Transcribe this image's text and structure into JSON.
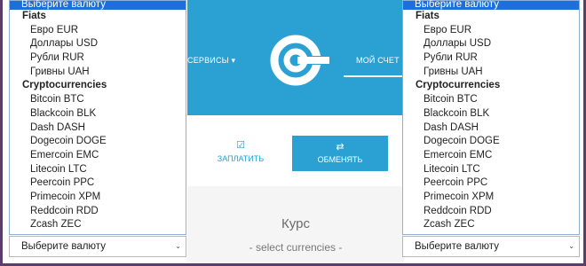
{
  "nav": {
    "services": "СЕРВИСЫ ▾",
    "account": "МОЙ СЧЕТ"
  },
  "actions": {
    "pay_icon": "☑",
    "pay": "ЗАПЛАТИТЬ",
    "exchange_icon": "⇄",
    "exchange": "ОБМЕНЯТЬ"
  },
  "rate": {
    "title": "Курс",
    "subtitle": "- select currencies -"
  },
  "dropdown": {
    "selected": "Выберите валюту",
    "fiats_label": "Fiats",
    "fiats": [
      "Евро EUR",
      "Доллары USD",
      "Рубли RUR",
      "Гривны UAH"
    ],
    "crypto_label": "Cryptocurrencies",
    "crypto": [
      "Bitcoin BTC",
      "Blackcoin BLK",
      "Dash DASH",
      "Dogecoin DOGE",
      "Emercoin EMC",
      "Litecoin LTC",
      "Peercoin PPC",
      "Primecoin XPM",
      "Reddcoin RDD",
      "Zcash ZEC"
    ]
  },
  "select": {
    "value": "Выберите валюту",
    "caret_icon": "chevron-down"
  },
  "colors": {
    "brand": "#2ba1d3",
    "selected_option": "#1e6fdb",
    "frame": "#5a3d6a"
  }
}
